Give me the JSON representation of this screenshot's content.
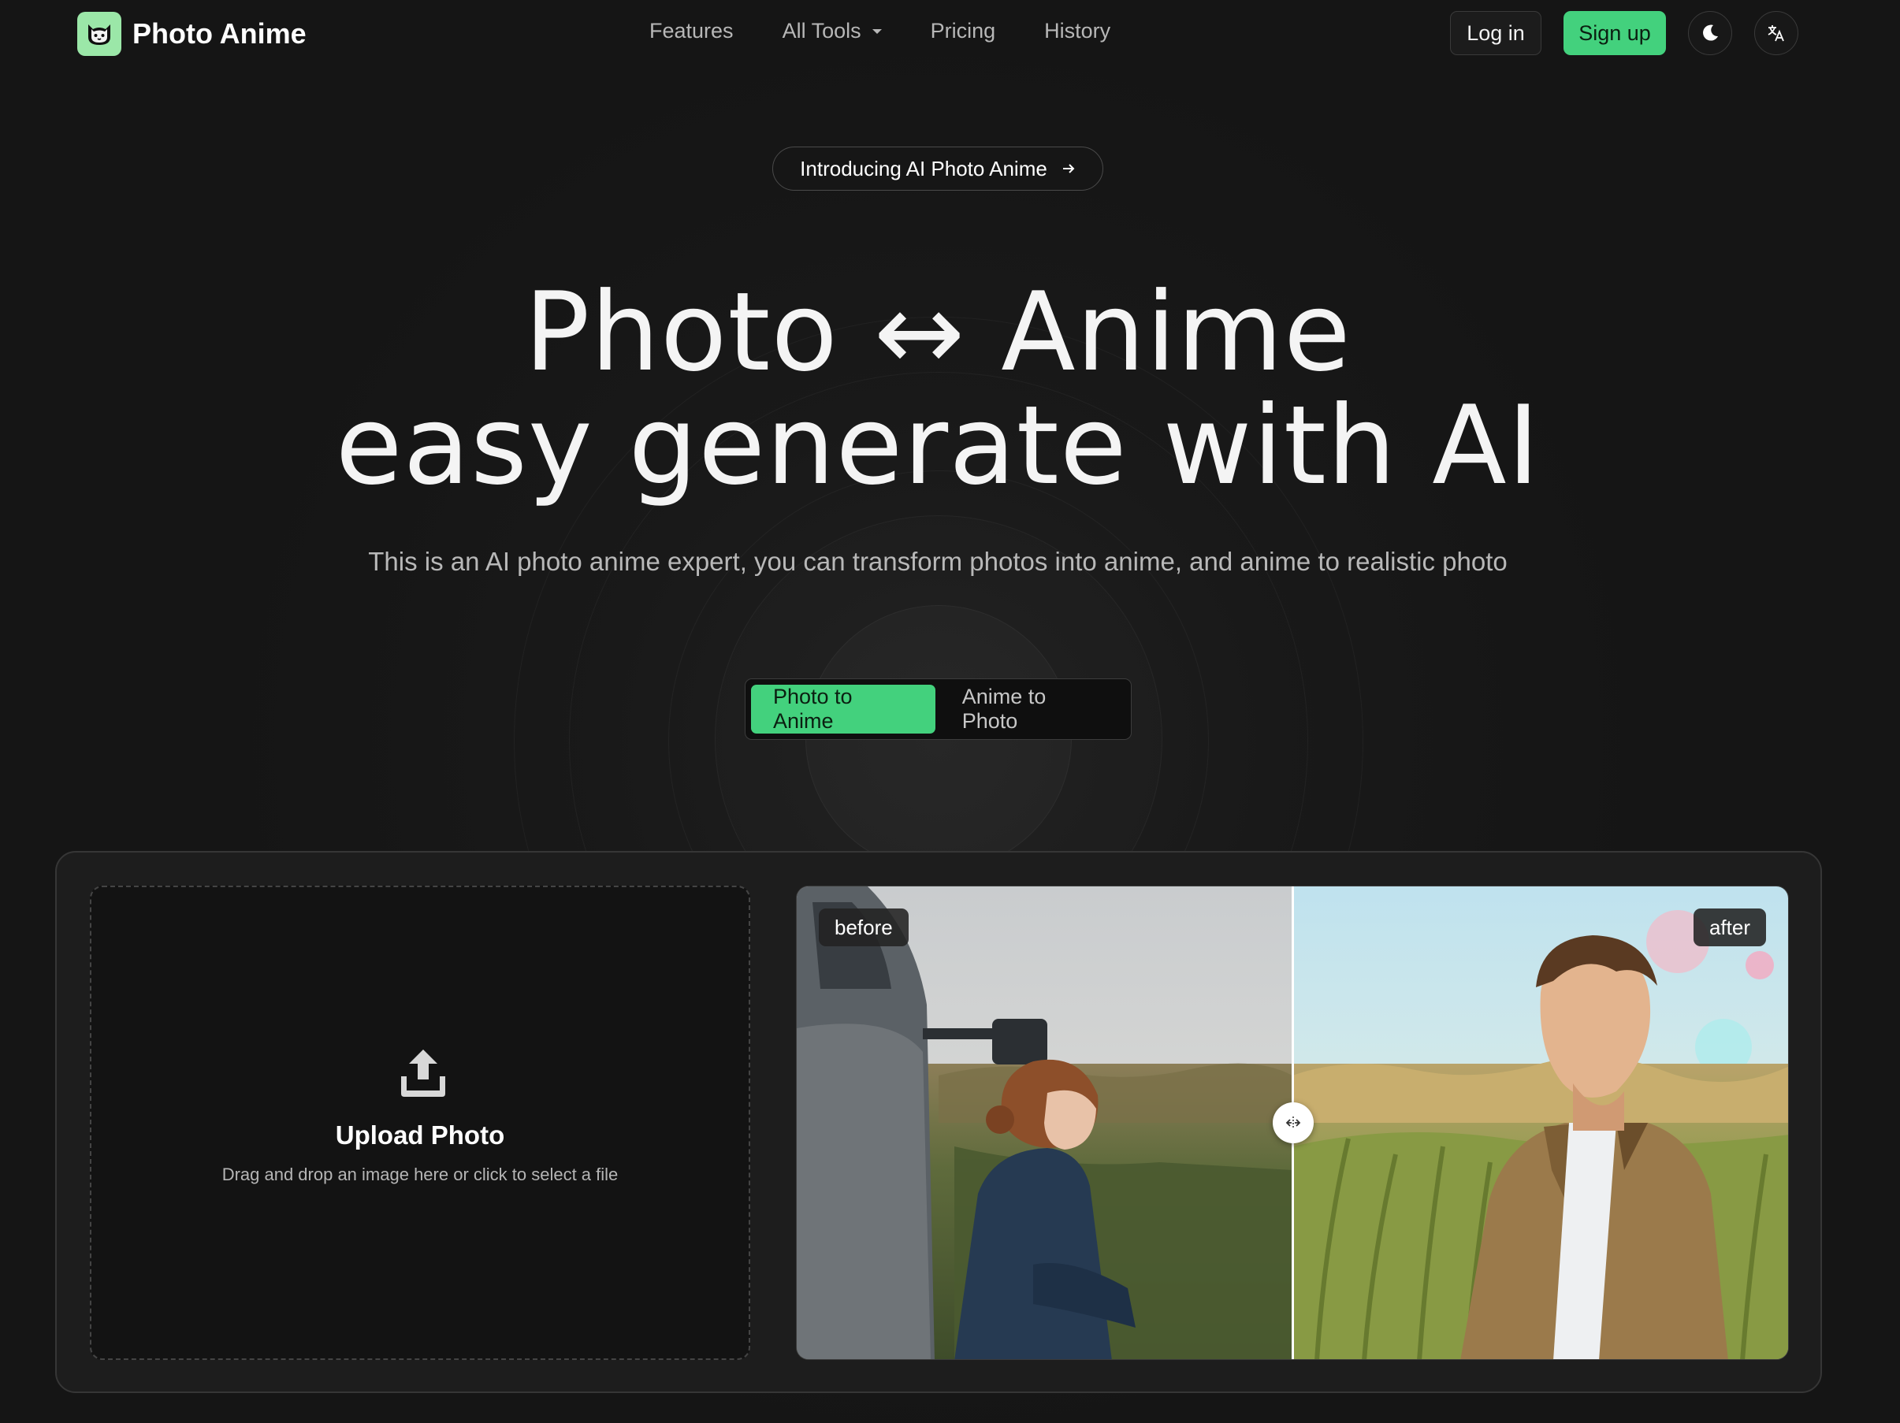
{
  "brand": {
    "name": "Photo Anime",
    "logo_icon": "cat-icon",
    "accent_color": "#43d17d"
  },
  "nav": {
    "features": "Features",
    "all_tools": "All Tools",
    "pricing": "Pricing",
    "history": "History"
  },
  "header_actions": {
    "login": "Log in",
    "signup": "Sign up",
    "theme_icon": "moon-icon",
    "language_icon": "translate-icon"
  },
  "announcement": {
    "label": "Introducing AI Photo Anime",
    "icon": "arrow-right-icon"
  },
  "hero": {
    "title_line1": "Photo ↔ Anime",
    "title_line2": "easy generate with AI",
    "subtitle": "This is an AI photo anime expert, you can transform photos into anime, and anime to realistic photo"
  },
  "mode_toggle": {
    "options": [
      "Photo to Anime",
      "Anime to Photo"
    ],
    "selected": "Photo to Anime"
  },
  "upload": {
    "title": "Upload Photo",
    "hint": "Drag and drop an image here or click to select a file",
    "icon": "upload-icon"
  },
  "comparison": {
    "before_label": "before",
    "after_label": "after",
    "handle_icon": "move-horizontal-icon"
  }
}
